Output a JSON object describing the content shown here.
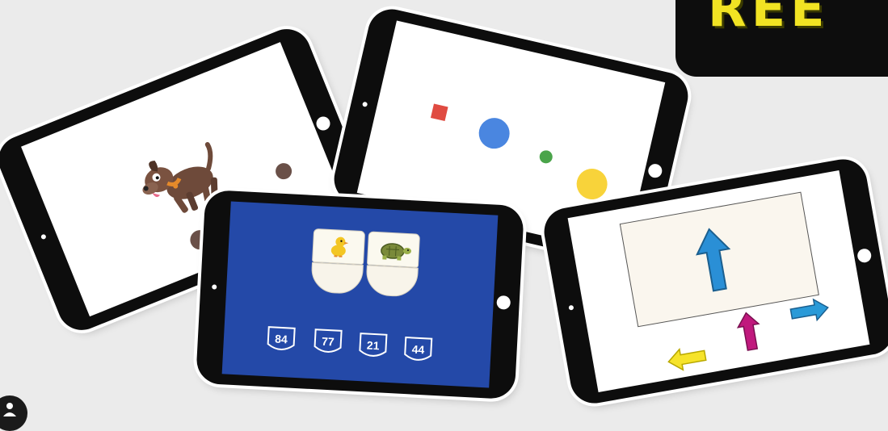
{
  "corner_panel": {
    "visible_text": "REE"
  },
  "tablets": {
    "dog": {
      "icons": [
        "dog-icon",
        "brown-dot"
      ]
    },
    "dots": {
      "shapes": [
        {
          "name": "red-square",
          "color": "#e04b41"
        },
        {
          "name": "blue-dot",
          "color": "#4a86e0"
        },
        {
          "name": "green-dot",
          "color": "#4aa44a"
        },
        {
          "name": "yellow-dot",
          "color": "#f8d33a"
        }
      ]
    },
    "math": {
      "screen_color": "#2449a8",
      "cards": [
        {
          "icon": "duck-icon"
        },
        {
          "icon": "turtle-icon"
        }
      ],
      "answers": [
        "84",
        "77",
        "21",
        "44"
      ]
    },
    "arrows": {
      "big_arrow": {
        "direction": "up",
        "color": "#2a8fd6"
      },
      "small_arrows": [
        {
          "direction": "left",
          "color": "#f6e32a"
        },
        {
          "direction": "up",
          "color": "#c0197d"
        },
        {
          "direction": "right",
          "color": "#2a9ad8"
        }
      ]
    }
  }
}
